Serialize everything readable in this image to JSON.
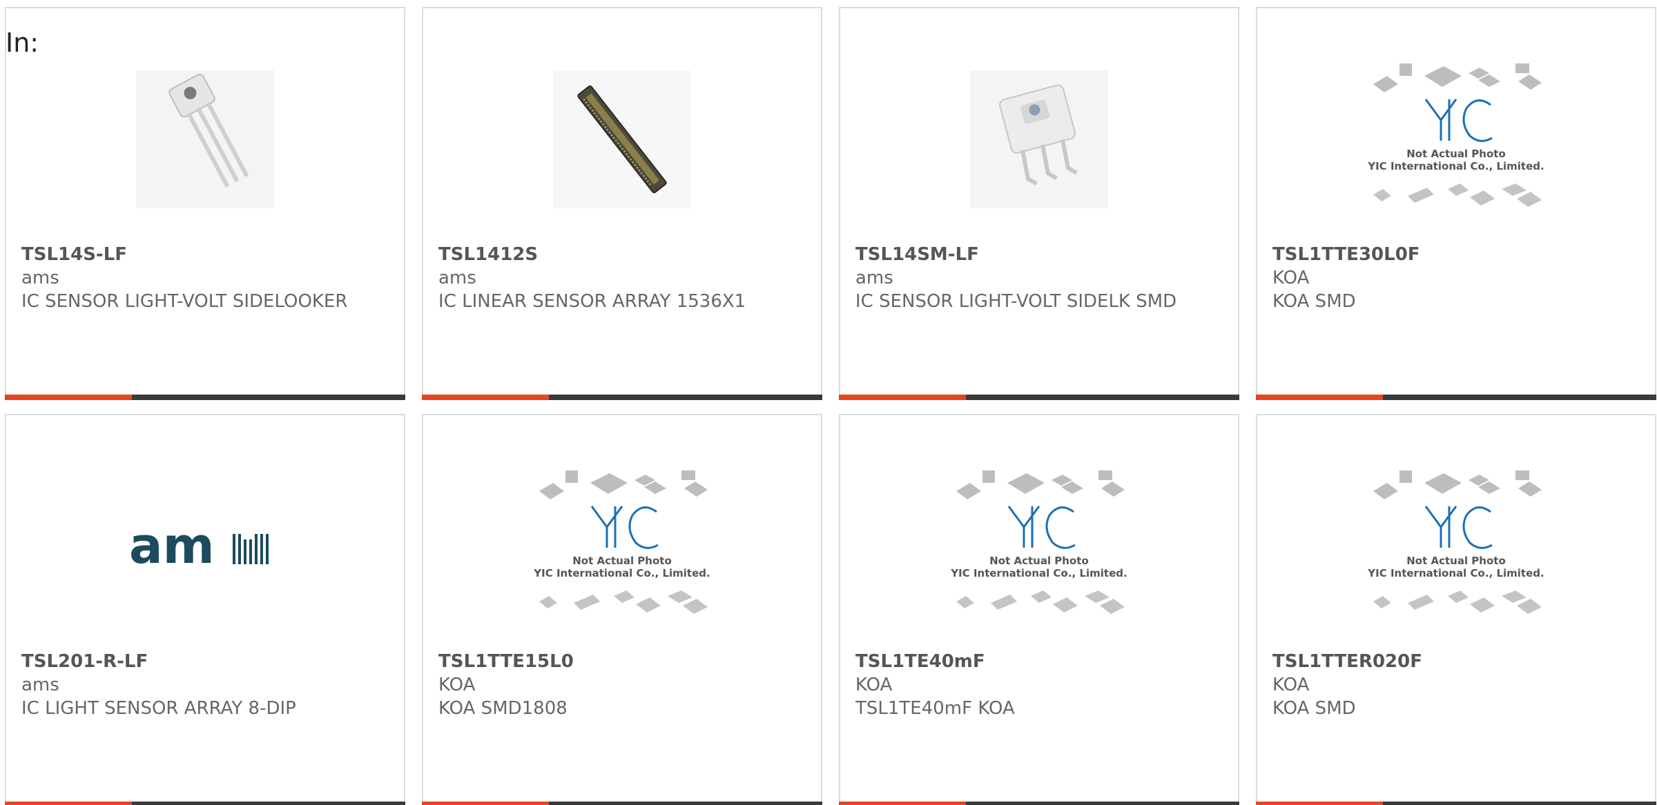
{
  "heading": "In:",
  "colors": {
    "accent": "#e8451f",
    "bar": "#3a3a3a",
    "border": "#dcdcdc",
    "text": "#666666",
    "ams_logo": "#1c4a5e",
    "yic_blue": "#1a6fb5"
  },
  "placeholder_image": {
    "line1": "Not Actual Photo",
    "line2": "YIC International Co., Limited.",
    "logo_text": "YIC"
  },
  "ams_logo_text": "am",
  "products": [
    {
      "part": "TSL14S-LF",
      "maker": "ams",
      "desc": "IC SENSOR LIGHT-VOLT SIDELOOKER",
      "image": "sensor-3pin-icon"
    },
    {
      "part": "TSL1412S",
      "maker": "ams",
      "desc": "IC LINEAR SENSOR ARRAY 1536X1",
      "image": "linear-array-icon"
    },
    {
      "part": "TSL14SM-LF",
      "maker": "ams",
      "desc": "IC SENSOR LIGHT-VOLT SIDELK SMD",
      "image": "sensor-smd-icon"
    },
    {
      "part": "TSL1TTE30L0F",
      "maker": "KOA",
      "desc": "KOA SMD",
      "image": "yic-placeholder"
    },
    {
      "part": "TSL201-R-LF",
      "maker": "ams",
      "desc": "IC LIGHT SENSOR ARRAY 8-DIP",
      "image": "ams-logo"
    },
    {
      "part": "TSL1TTE15L0",
      "maker": "KOA",
      "desc": "KOA SMD1808",
      "image": "yic-placeholder"
    },
    {
      "part": "TSL1TE40mF",
      "maker": "KOA",
      "desc": "TSL1TE40mF KOA",
      "image": "yic-placeholder"
    },
    {
      "part": "TSL1TTER020F",
      "maker": "KOA",
      "desc": "KOA SMD",
      "image": "yic-placeholder"
    }
  ]
}
